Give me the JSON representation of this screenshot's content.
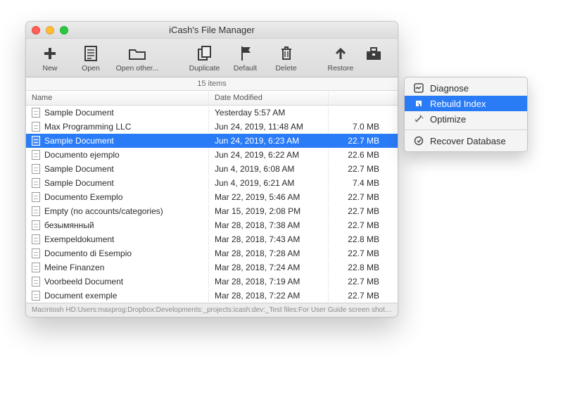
{
  "window": {
    "title": "iCash's File Manager"
  },
  "toolbar": {
    "new": "New",
    "open": "Open",
    "open_other": "Open other...",
    "duplicate": "Duplicate",
    "default": "Default",
    "delete": "Delete",
    "restore": "Restore"
  },
  "items_bar": "15 items",
  "columns": {
    "name": "Name",
    "date": "Date Modified"
  },
  "rows": [
    {
      "name": "Sample Document",
      "date": "Yesterday 5:57 AM",
      "size": ""
    },
    {
      "name": "Max Programming LLC",
      "date": "Jun 24, 2019, 11:48 AM",
      "size": "7.0 MB"
    },
    {
      "name": "Sample Document",
      "date": "Jun 24, 2019, 6:23 AM",
      "size": "22.7 MB",
      "selected": true
    },
    {
      "name": "Documento ejemplo",
      "date": "Jun 24, 2019, 6:22 AM",
      "size": "22.6 MB"
    },
    {
      "name": "Sample Document",
      "date": "Jun 4, 2019, 6:08 AM",
      "size": "22.7 MB"
    },
    {
      "name": "Sample Document",
      "date": "Jun 4, 2019, 6:21 AM",
      "size": "7.4 MB"
    },
    {
      "name": "Documento Exemplo",
      "date": "Mar 22, 2019, 5:46 AM",
      "size": "22.7 MB"
    },
    {
      "name": "Empty (no accounts/categories)",
      "date": "Mar 15, 2019, 2:08 PM",
      "size": "22.7 MB"
    },
    {
      "name": "безымянный",
      "date": "Mar 28, 2018, 7:38 AM",
      "size": "22.7 MB"
    },
    {
      "name": "Exempeldokument",
      "date": "Mar 28, 2018, 7:43 AM",
      "size": "22.8 MB"
    },
    {
      "name": "Documento di Esempio",
      "date": "Mar 28, 2018, 7:28 AM",
      "size": "22.7 MB"
    },
    {
      "name": "Meine Finanzen",
      "date": "Mar 28, 2018, 7:24 AM",
      "size": "22.8 MB"
    },
    {
      "name": "Voorbeeld Document",
      "date": "Mar 28, 2018, 7:19 AM",
      "size": "22.7 MB"
    },
    {
      "name": "Document exemple",
      "date": "Mar 28, 2018, 7:22 AM",
      "size": "22.7 MB"
    }
  ],
  "status": "Macintosh HD:Users:maxprog:Dropbox:Developments:_projects:icash:dev:_Test files:For User Guide screen shots:Sa",
  "menu": {
    "diagnose": "Diagnose",
    "rebuild": "Rebuild Index",
    "optimize": "Optimize",
    "recover": "Recover Database"
  }
}
